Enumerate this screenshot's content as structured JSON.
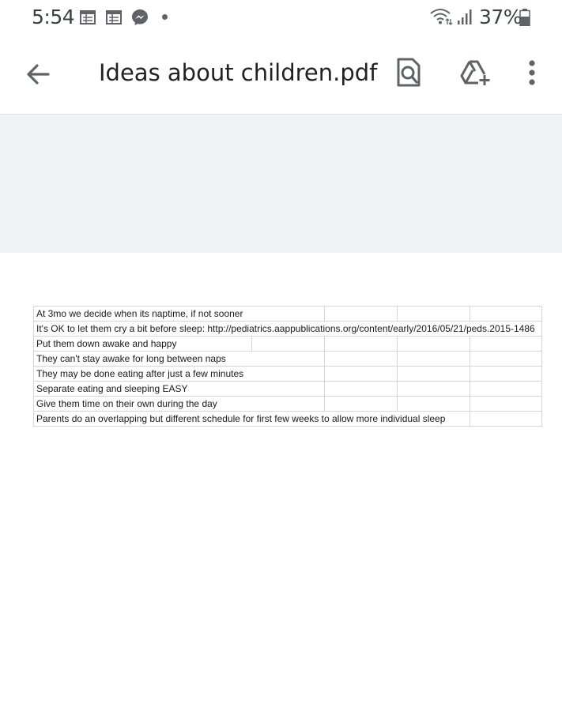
{
  "status_bar": {
    "time": "5:54",
    "battery_percent": "37%",
    "notification_icons": [
      "calendar-icon",
      "calendar-icon",
      "messenger-icon"
    ],
    "system_icons": [
      "wifi-icon",
      "signal-icon",
      "battery-icon"
    ]
  },
  "app_bar": {
    "title": "Ideas about children.pdf",
    "back_icon": "arrow-back-icon",
    "actions": [
      "find-in-page-icon",
      "add-to-drive-icon",
      "more-vert-icon"
    ]
  },
  "document": {
    "rows": [
      "At 3mo we decide when its naptime, if not sooner",
      "It's OK to let them cry a bit before sleep: http://pediatrics.aappublications.org/content/early/2016/05/21/peds.2015-1486",
      "Put them down awake and happy",
      "They can't stay awake for long between naps",
      "They may be done eating after just a few minutes",
      "Separate eating and sleeping EASY",
      "Give them time on their own during the day",
      "Parents do an overlapping but different schedule for first few weeks to allow more individual sleep"
    ]
  },
  "colors": {
    "band_gray": "#f1f2f3",
    "icon_gray": "#5f6368",
    "grid_line": "#d6d6d6"
  }
}
